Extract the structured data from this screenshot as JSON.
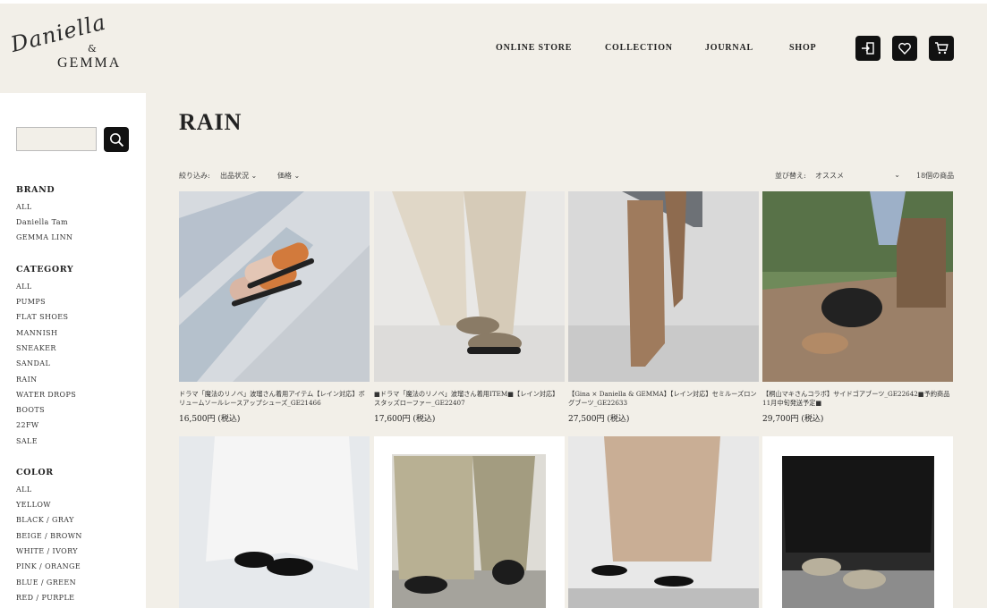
{
  "header": {
    "logo": {
      "script": "Daniella",
      "amp": "&",
      "brand": "GEMMA"
    },
    "nav": [
      "ONLINE STORE",
      "COLLECTION",
      "JOURNAL",
      "SHOP"
    ],
    "icons": [
      "login-icon",
      "heart-icon",
      "cart-icon"
    ]
  },
  "sidebar": {
    "search": {
      "value": "",
      "placeholder": ""
    },
    "brand": {
      "heading": "BRAND",
      "items": [
        "ALL",
        "Daniella Tam",
        "GEMMA LINN"
      ]
    },
    "category": {
      "heading": "CATEGORY",
      "items": [
        "ALL",
        "PUMPS",
        "FLAT SHOES",
        "MANNISH",
        "SNEAKER",
        "SANDAL",
        "RAIN",
        "WATER DROPS",
        "BOOTS",
        "22FW",
        "SALE"
      ]
    },
    "color": {
      "heading": "COLOR",
      "items": [
        "ALL",
        "YELLOW",
        "BLACK / GRAY",
        "BEIGE / BROWN",
        "WHITE / IVORY",
        "PINK / ORANGE",
        "BLUE / GREEN",
        "RED / PURPLE"
      ]
    }
  },
  "main": {
    "title": "RAIN",
    "filter": {
      "label": "絞り込み:",
      "stock": "出品状況",
      "price": "価格"
    },
    "sort": {
      "label": "並び替え:",
      "value": "オススメ",
      "count": "18個の商品"
    },
    "products": [
      {
        "title": "ドラマ「魔法のリノベ」波瑠さん着用アイテム【レイン対応】ボリュームソールレースアップシューズ_GE21466",
        "price": "16,500円 (税込)"
      },
      {
        "title": "■ドラマ「魔法のリノベ」波瑠さん着用ITEM■【レイン対応】スタッズローファー_GE22407",
        "price": "17,600円 (税込)"
      },
      {
        "title": "【Gina × Daniella & GEMMA】【レイン対応】セミルーズロングブーツ_GE22633",
        "price": "27,500円 (税込)"
      },
      {
        "title": "【桐山マキさんコラボ】サイドゴアブーツ_GE22642■予約商品11月中旬発送予定■",
        "price": "29,700円 (税込)"
      },
      {
        "title": "",
        "price": ""
      },
      {
        "title": "",
        "price": ""
      },
      {
        "title": "",
        "price": ""
      },
      {
        "title": "",
        "price": ""
      }
    ]
  },
  "colors": {
    "background": "#f2efe8",
    "sidebar": "#ffffff",
    "icon_bg": "#111111"
  }
}
